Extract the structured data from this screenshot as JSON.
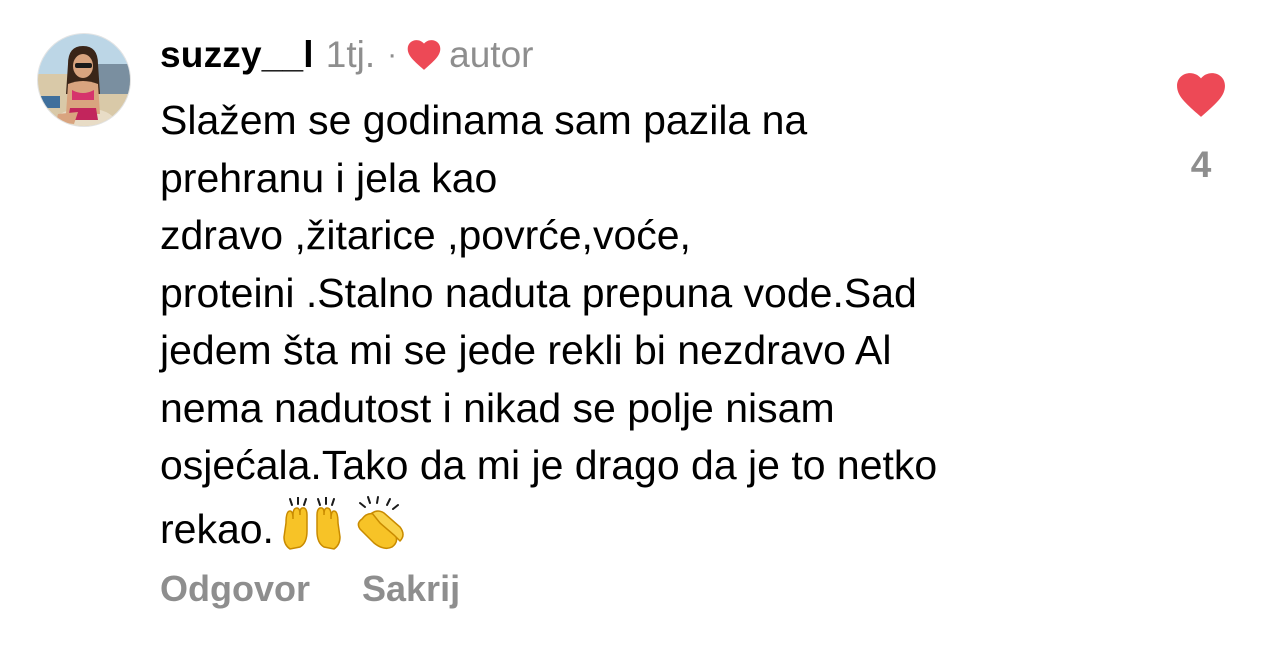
{
  "comment": {
    "username": "suzzy__l",
    "time": "1tj.",
    "separator": "·",
    "author_label": "autor",
    "text_lines": [
      "Slažem se godinama sam pazila na",
      "prehranu i jela kao",
      "zdravo ,žitarice ,povrće,voće,",
      "proteini .Stalno naduta prepuna vode.Sad",
      "jedem šta mi se jede rekli bi nezdravo Al",
      "nema nadutost i nikad se polje nisam",
      "osjećala.Tako da mi je drago da je to netko",
      "rekao."
    ],
    "emojis": [
      "raising-hands-icon",
      "clapping-hands-icon"
    ],
    "actions": {
      "reply": "Odgovor",
      "hide": "Sakrij"
    },
    "likes": {
      "count": "4",
      "liked": true
    }
  },
  "colors": {
    "heart": "#ed4956",
    "muted": "#8e8e8e",
    "text": "#000000",
    "emoji_yellow": "#f7c327"
  }
}
